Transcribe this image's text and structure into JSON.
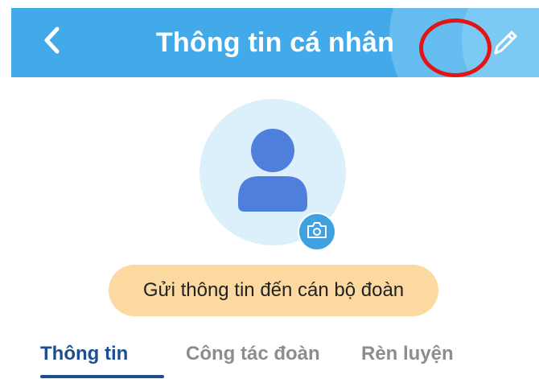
{
  "header": {
    "title": "Thông tin cá nhân",
    "back_icon": "chevron-left-icon",
    "edit_icon": "pencil-icon",
    "background": "#43aaea"
  },
  "profile": {
    "avatar_icon": "user-icon",
    "camera_icon": "camera-icon"
  },
  "actions": {
    "send_label": "Gửi thông tin đến cán bộ đoàn",
    "send_bg": "#fbd9a0"
  },
  "tabs": [
    {
      "label": "Thông tin",
      "active": true
    },
    {
      "label": "Công tác đoàn",
      "active": false
    },
    {
      "label": "Rèn luyện",
      "active": false
    }
  ],
  "colors": {
    "accent": "#1d4f8c",
    "avatar_bg": "#dcf0fb",
    "avatar_fg": "#4f7fdc",
    "highlight": "#e41414"
  }
}
